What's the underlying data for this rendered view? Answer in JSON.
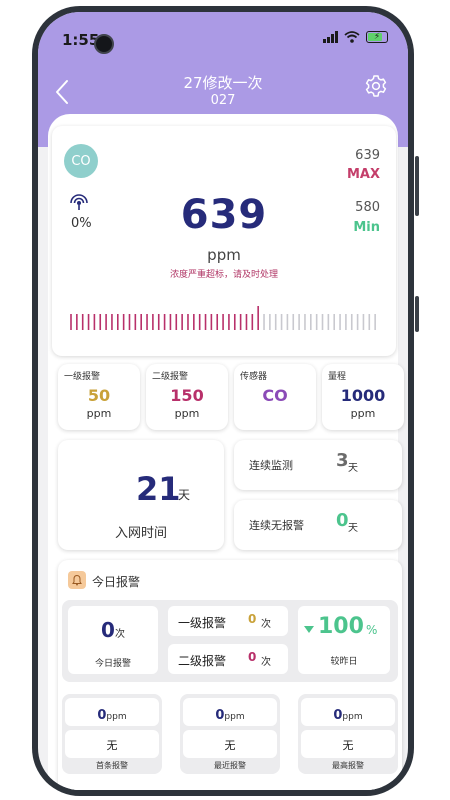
{
  "status_bar": {
    "time": "1:55"
  },
  "header": {
    "title": "27修改一次",
    "subtitle": "027"
  },
  "sensor": {
    "gas_badge": "CO",
    "signal_percent": "0%",
    "current_value": "639",
    "unit": "ppm",
    "warning": "浓度严重超标，请及时处理",
    "max_value": "639",
    "max_label": "MAX",
    "min_value": "580",
    "min_label": "Min",
    "gauge_level": 0.62
  },
  "thresholds": [
    {
      "label": "一级报警",
      "value": "50",
      "unit": "ppm",
      "color": "#c9a23a"
    },
    {
      "label": "二级报警",
      "value": "150",
      "unit": "ppm",
      "color": "#b8306a"
    },
    {
      "label": "传感器",
      "value": "CO",
      "unit": "",
      "color": "#8b4bb7"
    },
    {
      "label": "量程",
      "value": "1000",
      "unit": "ppm",
      "color": "#262b7a"
    }
  ],
  "network": {
    "days": "21",
    "unit": "天",
    "label": "入网时间"
  },
  "monitoring": {
    "label": "连续监测",
    "value": "3",
    "unit": "天"
  },
  "no_alarm": {
    "label": "连续无报警",
    "value": "0",
    "unit": "天"
  },
  "today": {
    "title": "今日报警",
    "count": "0",
    "count_unit": "次",
    "count_label": "今日报警",
    "level1_label": "一级报警",
    "level1_value": "0",
    "level1_unit": "次",
    "level2_label": "二级报警",
    "level2_value": "0",
    "level2_unit": "次",
    "compare_value": "100",
    "compare_unit": "%",
    "compare_label": "较昨日"
  },
  "records": [
    {
      "value": "0",
      "unit": "ppm",
      "text": "无",
      "caption": "首条报警"
    },
    {
      "value": "0",
      "unit": "ppm",
      "text": "无",
      "caption": "最近报警"
    },
    {
      "value": "0",
      "unit": "ppm",
      "text": "无",
      "caption": "最高报警"
    }
  ],
  "colors": {
    "header": "#ab9ae5",
    "primary": "#262b7a",
    "gauge_active": "#b8306a",
    "gauge_inactive": "#c9c9cf",
    "good": "#4cc48d"
  }
}
